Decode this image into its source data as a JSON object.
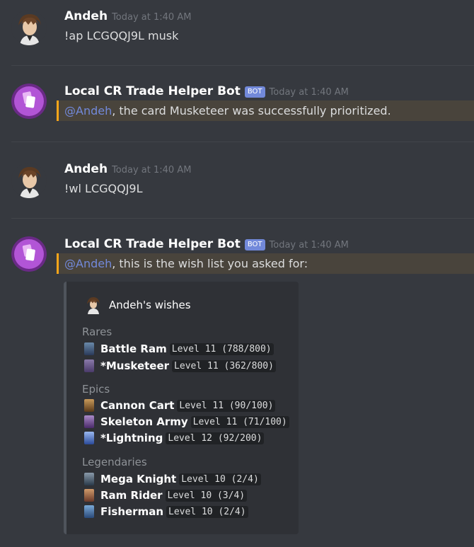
{
  "messages": [
    {
      "author": "Andeh",
      "timestamp": "Today at 1:40 AM",
      "text": "!ap LCGQQJ9L musk"
    },
    {
      "author": "Local CR Trade Helper Bot",
      "bot_tag": "BOT",
      "timestamp": "Today at 1:40 AM",
      "mention": "@Andeh",
      "text": ", the card Musketeer was successfully prioritized."
    },
    {
      "author": "Andeh",
      "timestamp": "Today at 1:40 AM",
      "text": "!wl LCGQQJ9L"
    },
    {
      "author": "Local CR Trade Helper Bot",
      "bot_tag": "BOT",
      "timestamp": "Today at 1:40 AM",
      "mention": "@Andeh",
      "text": ", this is the wish list you asked for:"
    }
  ],
  "embed": {
    "author": "Andeh's wishes",
    "sections": [
      {
        "title": "Rares",
        "cards": [
          {
            "name": "Battle Ram",
            "level": "Level 11 (788/800)",
            "color": "#4a6a8a"
          },
          {
            "name": "*Musketeer",
            "level": "Level 11 (362/800)",
            "color": "#6a5a8a"
          }
        ]
      },
      {
        "title": "Epics",
        "cards": [
          {
            "name": "Cannon Cart",
            "level": "Level 11 (90/100)",
            "color": "#8a6a3a"
          },
          {
            "name": "Skeleton Army",
            "level": "Level 11 (71/100)",
            "color": "#7a5a9a"
          },
          {
            "name": "*Lightning",
            "level": "Level 12 (92/200)",
            "color": "#5a7aba"
          }
        ]
      },
      {
        "title": "Legendaries",
        "cards": [
          {
            "name": "Mega Knight",
            "level": "Level 10 (2/4)",
            "color": "#5a6a7a"
          },
          {
            "name": "Ram Rider",
            "level": "Level 10 (3/4)",
            "color": "#a06a4a"
          },
          {
            "name": "Fisherman",
            "level": "Level 10 (2/4)",
            "color": "#4a7aaa"
          }
        ]
      }
    ]
  },
  "colors": {
    "background": "#36393f",
    "mention": "#7289da",
    "highlight": "#49443c",
    "highlight_bar": "#faa61a",
    "bot_tag": "#7289da",
    "embed": "#2f3136"
  }
}
